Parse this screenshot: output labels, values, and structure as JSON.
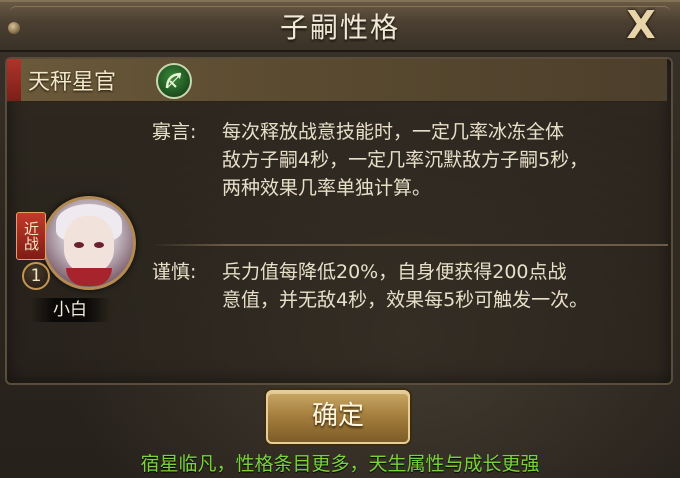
{
  "dialog": {
    "title": "子嗣性格",
    "close_label": "X"
  },
  "trait": {
    "name": "天秤星官",
    "icon": "bow-icon"
  },
  "personalities": [
    {
      "label": "寡言:",
      "lines": [
        "每次释放战意技能时，一定几率冰冻全体",
        "敌方子嗣4秒，一定几率沉默敌方子嗣5秒，",
        "两种效果几率单独计算。"
      ]
    },
    {
      "label": "谨慎:",
      "lines": [
        "兵力值每降低20%，自身便获得200点战",
        "意值，并无敌4秒，效果每5秒可触发一次。"
      ]
    }
  ],
  "hero": {
    "type_tag": "近战",
    "level": "1",
    "name": "小白"
  },
  "confirm_label": "确定",
  "promo_text": "宿星临凡，性格条目更多，天生属性与成长更强",
  "colors": {
    "accent_text": "#e8dfc9",
    "promo": "#79d23c",
    "banner_red": "#b0342a"
  }
}
